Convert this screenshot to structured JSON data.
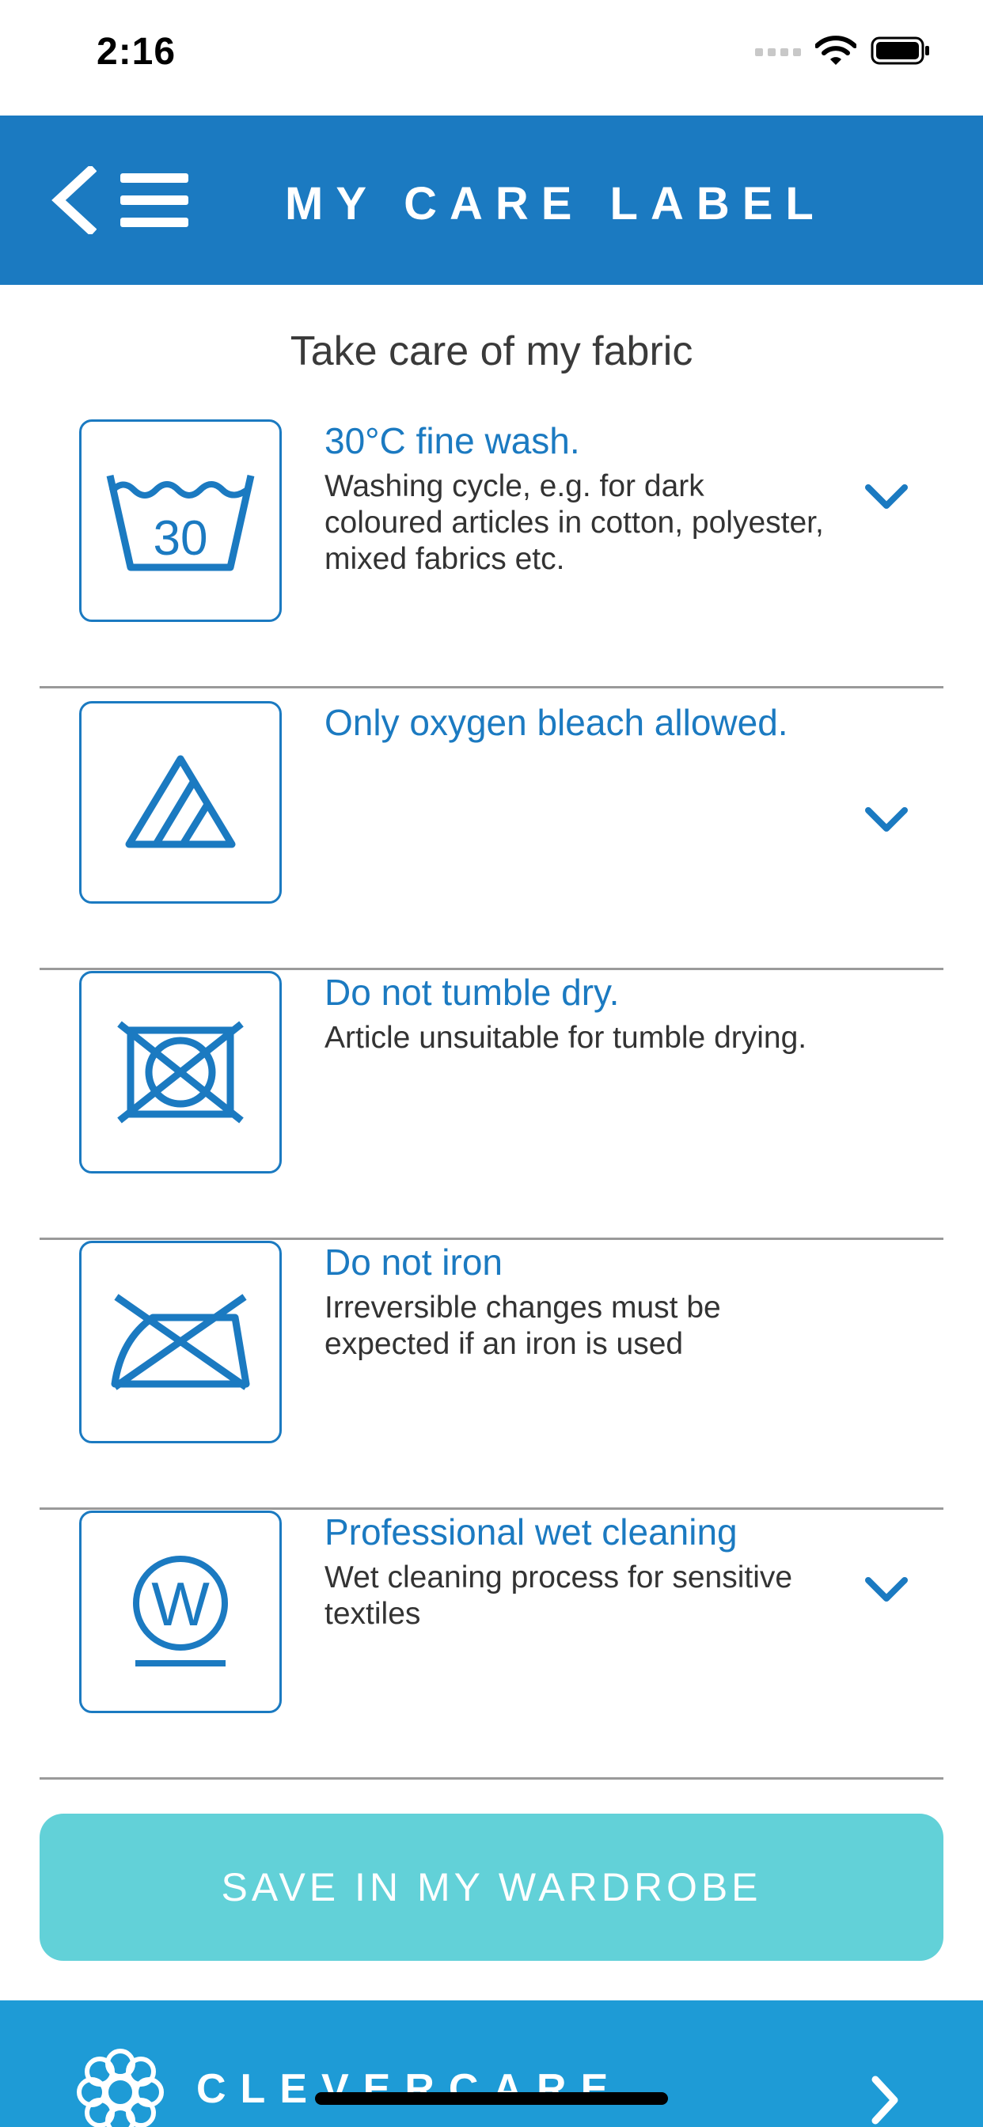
{
  "status": {
    "time": "2:16"
  },
  "header": {
    "title": "MY CARE LABEL",
    "back_icon": "chevron-left-icon",
    "menu_icon": "hamburger-menu-icon"
  },
  "section_title": "Take care of my fabric",
  "care_items": [
    {
      "symbol": "30",
      "icon": "wash-30-icon",
      "title": "30°C fine wash.",
      "description": "Washing cycle, e.g. for dark coloured articles in cotton, polyester, mixed fabrics etc.",
      "expandable": true
    },
    {
      "icon": "oxygen-bleach-icon",
      "title": "Only oxygen bleach allowed.",
      "description": "",
      "expandable": true
    },
    {
      "icon": "no-tumble-dry-icon",
      "title": "Do not tumble dry.",
      "description": "Article unsuitable for tumble drying.",
      "expandable": false
    },
    {
      "icon": "no-iron-icon",
      "title": "Do not iron",
      "description": "Irreversible changes must be expected if an iron is used",
      "expandable": false
    },
    {
      "symbol": "W",
      "icon": "wet-cleaning-icon",
      "title": "Professional wet cleaning",
      "description": "Wet cleaning process for sensitive textiles",
      "expandable": true
    }
  ],
  "save_button": {
    "label": "SAVE IN MY WARDROBE"
  },
  "footer": {
    "label": "CLEVERCARE",
    "icon": "flower-icon"
  },
  "colors": {
    "primary": "#1b7ac1",
    "footer": "#1e9bd6",
    "save_button": "#62d1d8",
    "divider": "#9a9a9a"
  }
}
